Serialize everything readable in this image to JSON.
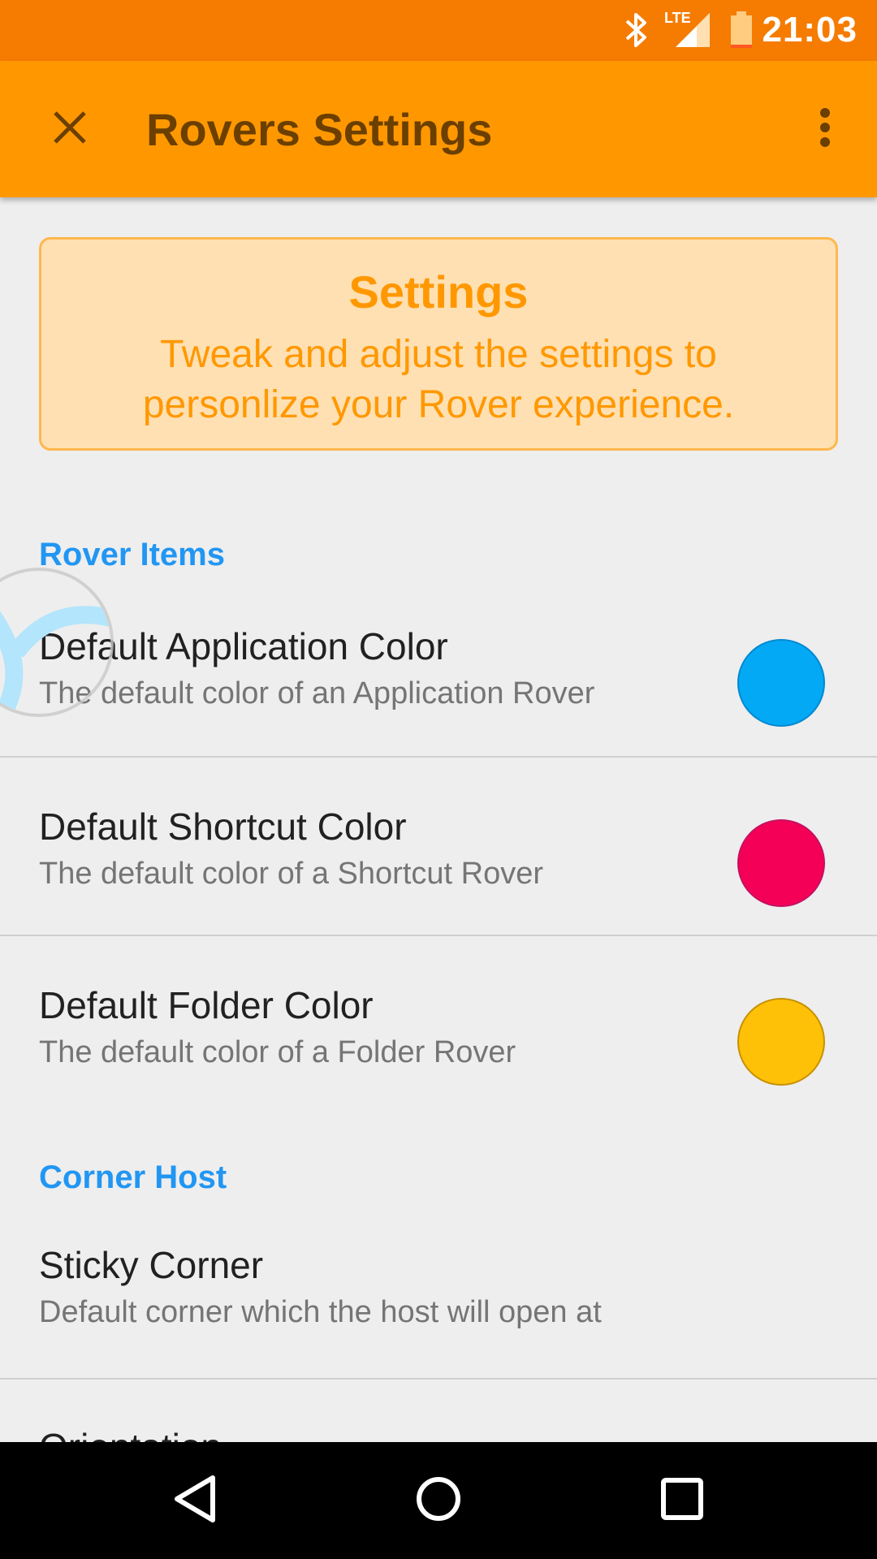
{
  "status_bar": {
    "time": "21:03",
    "network_label": "LTE",
    "icons": [
      "bluetooth-icon",
      "signal-icon",
      "battery-icon"
    ]
  },
  "app_bar": {
    "title": "Rovers Settings",
    "close_icon": "close-icon",
    "menu_icon": "more-vert-icon"
  },
  "banner": {
    "title": "Settings",
    "line1": "Tweak and adjust the settings to",
    "line2": "personlize your Rover experience."
  },
  "sections": [
    {
      "header": "Rover Items",
      "items": [
        {
          "title": "Default Application Color",
          "summary": "The default color of an Application Rover",
          "color": "#03a9f4"
        },
        {
          "title": "Default Shortcut Color",
          "summary": "The default color of a Shortcut Rover",
          "color": "#f50057"
        },
        {
          "title": "Default Folder Color",
          "summary": "The default color of a Folder Rover",
          "color": "#ffc107"
        }
      ]
    },
    {
      "header": "Corner Host",
      "items": [
        {
          "title": "Sticky Corner",
          "summary": "Default corner which the host will open at"
        },
        {
          "title": "Orientation"
        }
      ]
    }
  ],
  "nav_bar": {
    "buttons": [
      "back-icon",
      "home-icon",
      "recents-icon"
    ]
  },
  "colors": {
    "status_bar": "#f57c00",
    "app_bar": "#ff9800",
    "accent": "#2196f3",
    "banner_bg": "#ffe0b2"
  }
}
